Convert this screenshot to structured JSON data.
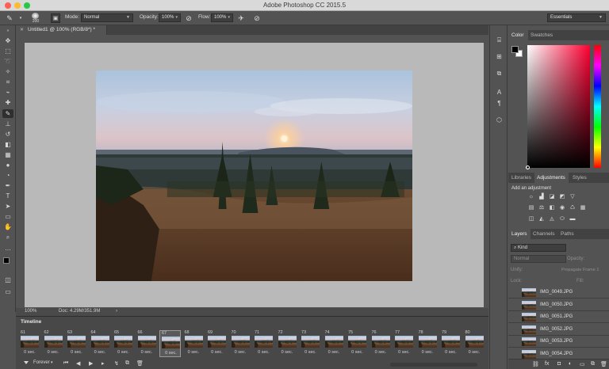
{
  "window": {
    "title": "Adobe Photoshop CC 2015.5"
  },
  "options": {
    "brush_size": "200",
    "mode_label": "Mode:",
    "mode_value": "Normal",
    "opacity_label": "Opacity:",
    "opacity_value": "100%",
    "flow_label": "Flow:",
    "flow_value": "100%",
    "workspace": "Essentials"
  },
  "document": {
    "tab_title": "Untitled1 @ 100% (RGB/8*) *",
    "zoom": "100%",
    "doc_info": "Doc: 4.29M/351.9M"
  },
  "timeline": {
    "title": "Timeline",
    "loop": "Forever",
    "frames": [
      {
        "num": "61",
        "dur": "0 sec."
      },
      {
        "num": "62",
        "dur": "0 sec."
      },
      {
        "num": "63",
        "dur": "0 sec."
      },
      {
        "num": "64",
        "dur": "0 sec."
      },
      {
        "num": "65",
        "dur": "0 sec."
      },
      {
        "num": "66",
        "dur": "0 sec."
      },
      {
        "num": "67",
        "dur": "0 sec."
      },
      {
        "num": "68",
        "dur": "0 sec."
      },
      {
        "num": "69",
        "dur": "0 sec."
      },
      {
        "num": "70",
        "dur": "0 sec."
      },
      {
        "num": "71",
        "dur": "0 sec."
      },
      {
        "num": "72",
        "dur": "0 sec."
      },
      {
        "num": "73",
        "dur": "0 sec."
      },
      {
        "num": "74",
        "dur": "0 sec."
      },
      {
        "num": "75",
        "dur": "0 sec."
      },
      {
        "num": "76",
        "dur": "0 sec."
      },
      {
        "num": "77",
        "dur": "0 sec."
      },
      {
        "num": "78",
        "dur": "0 sec."
      },
      {
        "num": "79",
        "dur": "0 sec."
      },
      {
        "num": "80",
        "dur": "0 sec."
      }
    ],
    "selected_frame": "67"
  },
  "color_panel": {
    "tabs": [
      "Color",
      "Swatches"
    ],
    "active_tab": "Color"
  },
  "adjustments_panel": {
    "tabs": [
      "Libraries",
      "Adjustments",
      "Styles"
    ],
    "active_tab": "Adjustments",
    "heading": "Add an adjustment"
  },
  "layers_panel": {
    "tabs": [
      "Layers",
      "Channels",
      "Paths"
    ],
    "active_tab": "Layers",
    "filter": "Kind",
    "blend_mode": "Normal",
    "opacity_label": "Opacity:",
    "unify_label": "Unify:",
    "propagate_label": "Propagate Frame 1",
    "lock_label": "Lock:",
    "fill_label": "Fill:",
    "layers": [
      {
        "name": "IMG_0049.JPG"
      },
      {
        "name": "IMG_0050.JPG"
      },
      {
        "name": "IMG_0051.JPG"
      },
      {
        "name": "IMG_0052.JPG"
      },
      {
        "name": "IMG_0053.JPG"
      },
      {
        "name": "IMG_0054.JPG"
      }
    ]
  },
  "colors": {
    "accent": "#2b66b9",
    "panel_bg": "#535353",
    "canvas_bg": "#b9b9b9"
  }
}
